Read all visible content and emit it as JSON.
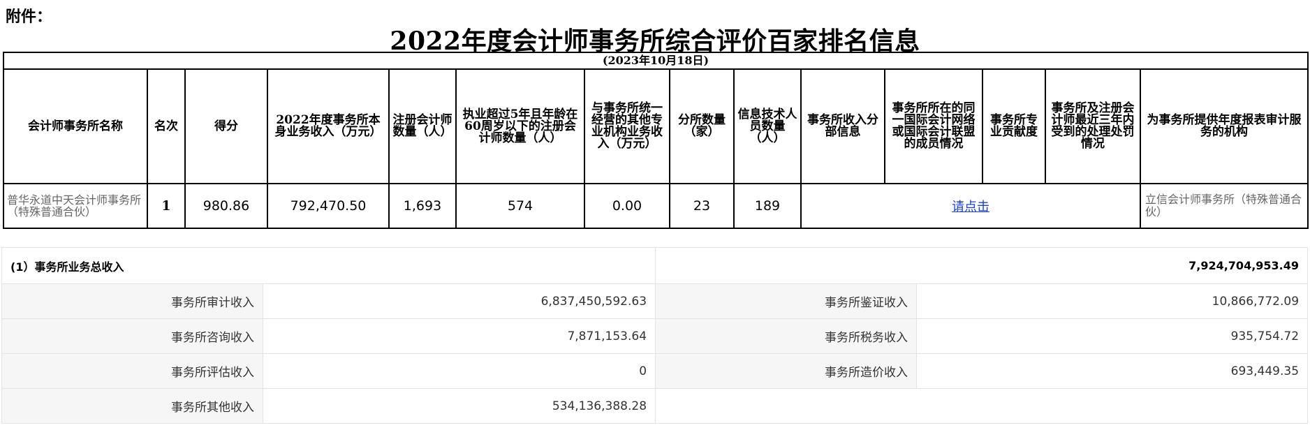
{
  "header": {
    "attachment": "附件：",
    "title": "2022年度会计师事务所综合评价百家排名信息",
    "date": "(2023年10月18日)"
  },
  "columns": [
    "会计师事务所名称",
    "名次",
    "得分",
    "2022年度事务所本身业务收入（万元）",
    "注册会计师数量（人）",
    "执业超过5年且年龄在60周岁以下的注册会计师数量（人）",
    "与事务所统一经营的其他专业机构业务收入（万元）",
    "分所数量（家）",
    "信息技术人员数量（人）",
    "事务所收入分部信息",
    "事务所所在的同一国际会计网络或国际会计联盟的成员情况",
    "事务所专业贡献度",
    "事务所及注册会计师最近三年内受到的处理处罚情况",
    "为事务所提供年度报表审计服务的机构"
  ],
  "row": {
    "firm": "普华永道中天会计师事务所（特殊普通合伙）",
    "rank": "1",
    "score": "980.86",
    "revenue": "792,470.50",
    "cpa_count": "1,693",
    "cpa_5yr": "574",
    "other_revenue": "0.00",
    "branches": "23",
    "it_staff": "189",
    "link_text": "请点击",
    "auditor": "立信会计师事务所（特殊普通合伙）"
  },
  "income": {
    "total_label": "(1）事务所业务总收入",
    "total_value": "7,924,704,953.49",
    "items": [
      {
        "label": "事务所审计收入",
        "value": "6,837,450,592.63"
      },
      {
        "label": "事务所鉴证收入",
        "value": "10,866,772.09"
      },
      {
        "label": "事务所咨询收入",
        "value": "7,871,153.64"
      },
      {
        "label": "事务所税务收入",
        "value": "935,754.72"
      },
      {
        "label": "事务所评估收入",
        "value": "0"
      },
      {
        "label": "事务所造价收入",
        "value": "693,449.35"
      },
      {
        "label": "事务所其他收入",
        "value": "534,136,388.28"
      }
    ]
  }
}
